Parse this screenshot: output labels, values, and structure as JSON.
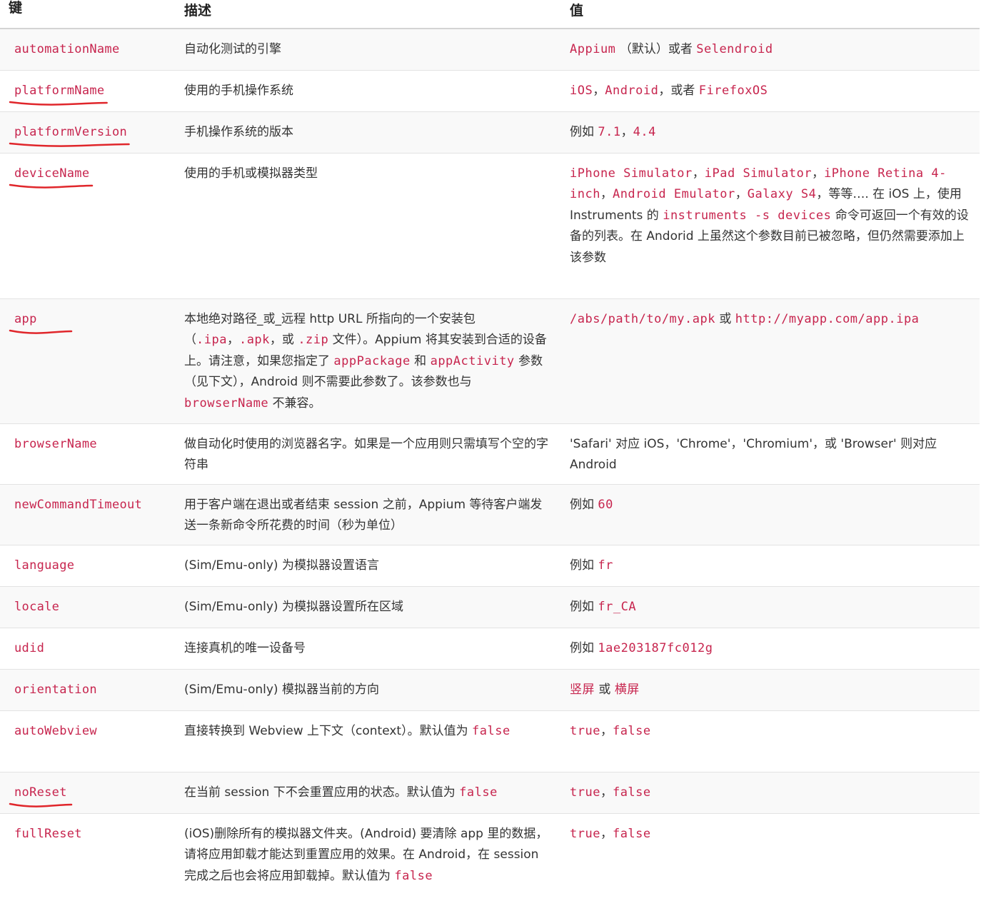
{
  "header": {
    "col_key": "键",
    "col_desc": "描述",
    "col_value": "值"
  },
  "rows": [
    {
      "key": "automationName",
      "desc": "自动化测试的引擎",
      "value": [
        {
          "t": "Appium",
          "c": 1
        },
        {
          "t": " （默认）或者 ",
          "c": 0
        },
        {
          "t": "Selendroid",
          "c": 1
        }
      ]
    },
    {
      "key": "platformName",
      "desc": "使用的手机操作系统",
      "value": [
        {
          "t": "iOS",
          "c": 1
        },
        {
          "t": "，",
          "c": 0
        },
        {
          "t": "Android",
          "c": 1
        },
        {
          "t": "，或者 ",
          "c": 0
        },
        {
          "t": "FirefoxOS",
          "c": 1
        }
      ]
    },
    {
      "key": "platformVersion",
      "desc": "手机操作系统的版本",
      "value": [
        {
          "t": "例如 ",
          "c": 0
        },
        {
          "t": "7.1",
          "c": 1
        },
        {
          "t": "，",
          "c": 0
        },
        {
          "t": "4.4",
          "c": 1
        }
      ]
    },
    {
      "key": "deviceName",
      "desc": "使用的手机或模拟器类型",
      "value": [
        {
          "t": "iPhone Simulator",
          "c": 1
        },
        {
          "t": "，",
          "c": 0
        },
        {
          "t": "iPad Simulator",
          "c": 1
        },
        {
          "t": "，",
          "c": 0
        },
        {
          "t": "iPhone Retina 4-inch",
          "c": 1
        },
        {
          "t": "，",
          "c": 0
        },
        {
          "t": "Android Emulator",
          "c": 1
        },
        {
          "t": "，",
          "c": 0
        },
        {
          "t": "Galaxy S4",
          "c": 1
        },
        {
          "t": "，等等…. 在 iOS 上，使用 Instruments 的 ",
          "c": 0
        },
        {
          "t": "instruments -s devices",
          "c": 1
        },
        {
          "t": " 命令可返回一个有效的设备的列表。在 Andorid 上虽然这个参数目前已被忽略，但仍然需要添加上该参数",
          "c": 0
        }
      ]
    },
    {
      "key": "app",
      "desc": [
        {
          "t": "本地绝对路径_或_远程 http URL 所指向的一个安装包（",
          "c": 0
        },
        {
          "t": ".ipa",
          "c": 1
        },
        {
          "t": "，",
          "c": 0
        },
        {
          "t": ".apk",
          "c": 1
        },
        {
          "t": "，或 ",
          "c": 0
        },
        {
          "t": ".zip",
          "c": 1
        },
        {
          "t": " 文件）。Appium 将其安装到合适的设备上。请注意，如果您指定了 ",
          "c": 0
        },
        {
          "t": "appPackage",
          "c": 2
        },
        {
          "t": " 和 ",
          "c": 0
        },
        {
          "t": "appActivity",
          "c": 2
        },
        {
          "t": " 参数（见下文），Android 则不需要此参数了。该参数也与 ",
          "c": 0
        },
        {
          "t": "browserName",
          "c": 2
        },
        {
          "t": " 不兼容。",
          "c": 0
        }
      ],
      "value": [
        {
          "t": "/abs/path/to/my.apk",
          "c": 1
        },
        {
          "t": " 或 ",
          "c": 0
        },
        {
          "t": "http://myapp.com/app.ipa",
          "c": 1
        }
      ]
    },
    {
      "key": "browserName",
      "desc": "做自动化时使用的浏览器名字。如果是一个应用则只需填写个空的字符串",
      "value": [
        {
          "t": "'Safari' 对应 iOS，'Chrome'，'Chromium'，或 'Browser' 则对应 Android",
          "c": 0
        }
      ]
    },
    {
      "key": "newCommandTimeout",
      "desc": "用于客户端在退出或者结束 session 之前，Appium 等待客户端发送一条新命令所花费的时间（秒为单位）",
      "value": [
        {
          "t": "例如 ",
          "c": 0
        },
        {
          "t": "60",
          "c": 1
        }
      ]
    },
    {
      "key": "language",
      "desc": "(Sim/Emu-only) 为模拟器设置语言",
      "value": [
        {
          "t": "例如 ",
          "c": 0
        },
        {
          "t": "fr",
          "c": 1
        }
      ]
    },
    {
      "key": "locale",
      "desc": "(Sim/Emu-only) 为模拟器设置所在区域",
      "value": [
        {
          "t": "例如 ",
          "c": 0
        },
        {
          "t": "fr_CA",
          "c": 1
        }
      ]
    },
    {
      "key": "udid",
      "desc": "连接真机的唯一设备号",
      "value": [
        {
          "t": "例如 ",
          "c": 0
        },
        {
          "t": "1ae203187fc012g",
          "c": 1
        }
      ]
    },
    {
      "key": "orientation",
      "desc": "(Sim/Emu-only) 模拟器当前的方向",
      "value": [
        {
          "t": "竖屏",
          "c": 2
        },
        {
          "t": " 或 ",
          "c": 0
        },
        {
          "t": "横屏",
          "c": 2
        }
      ]
    },
    {
      "key": "autoWebview",
      "desc": [
        {
          "t": "直接转换到 Webview 上下文（context）。默认值为 ",
          "c": 0
        },
        {
          "t": "false",
          "c": 1
        }
      ],
      "value": [
        {
          "t": "true",
          "c": 1
        },
        {
          "t": "，",
          "c": 0
        },
        {
          "t": "false",
          "c": 1
        }
      ]
    },
    {
      "key": "noReset",
      "desc": [
        {
          "t": "在当前 session 下不会重置应用的状态。默认值为 ",
          "c": 0
        },
        {
          "t": "false",
          "c": 1
        }
      ],
      "value": [
        {
          "t": "true",
          "c": 1
        },
        {
          "t": "，",
          "c": 0
        },
        {
          "t": "false",
          "c": 1
        }
      ]
    },
    {
      "key": "fullReset",
      "desc": [
        {
          "t": "(iOS)删除所有的模拟器文件夹。(Android) 要清除 app 里的数据，请将应用卸载才能达到重置应用的效果。在 Android，在 session 完成之后也会将应用卸载掉。默认值为 ",
          "c": 0
        },
        {
          "t": "false",
          "c": 1
        }
      ],
      "value": [
        {
          "t": "true",
          "c": 1
        },
        {
          "t": "，",
          "c": 0
        },
        {
          "t": "false",
          "c": 1
        }
      ]
    }
  ],
  "annotations": {
    "underlined_keys": [
      "platformName",
      "platformVersion",
      "deviceName",
      "app",
      "noReset"
    ],
    "underline_color": "#e0262b"
  },
  "colors": {
    "code": "#c7254e",
    "text": "#333333",
    "row_stripe": "#f9f9f9",
    "border": "#e3e3e3"
  }
}
